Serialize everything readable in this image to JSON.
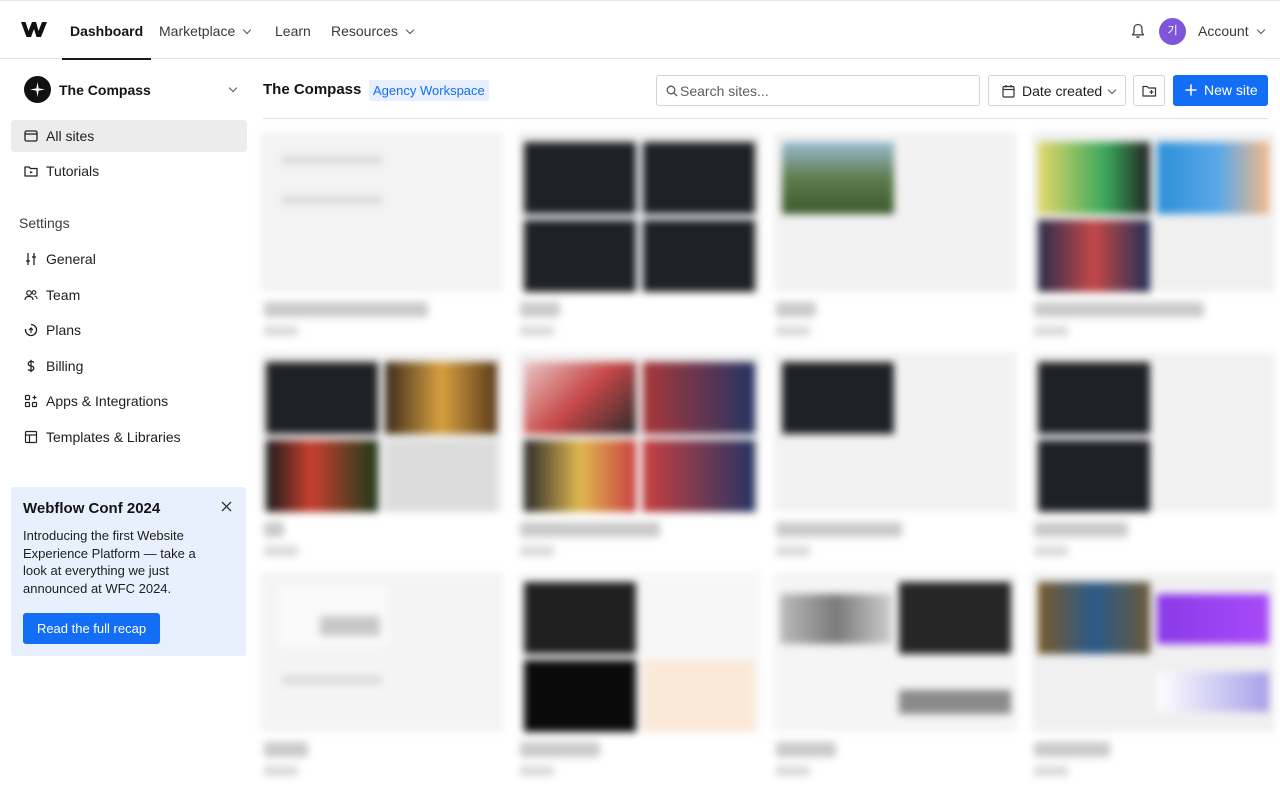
{
  "topnav": {
    "items": [
      {
        "label": "Dashboard",
        "active": true,
        "has_menu": false
      },
      {
        "label": "Marketplace",
        "active": false,
        "has_menu": true
      },
      {
        "label": "Learn",
        "active": false,
        "has_menu": false
      },
      {
        "label": "Resources",
        "active": false,
        "has_menu": true
      }
    ],
    "avatar_initial": "기",
    "account_label": "Account",
    "avatar_color": "#7d56d9"
  },
  "sidebar": {
    "workspace_name": "The Compass",
    "nav": [
      {
        "label": "All sites",
        "icon": "browser-window-icon",
        "active": true
      },
      {
        "label": "Tutorials",
        "icon": "video-folder-icon",
        "active": false
      }
    ],
    "settings_heading": "Settings",
    "settings": [
      {
        "label": "General",
        "icon": "sliders-icon"
      },
      {
        "label": "Team",
        "icon": "team-icon"
      },
      {
        "label": "Plans",
        "icon": "plans-icon"
      },
      {
        "label": "Billing",
        "icon": "dollar-icon"
      },
      {
        "label": "Apps & Integrations",
        "icon": "apps-icon"
      },
      {
        "label": "Templates & Libraries",
        "icon": "templates-icon"
      }
    ],
    "promo": {
      "title": "Webflow Conf 2024",
      "body": "Introducing the first Website Experience Platform — take a look at everything we just announced at WFC 2024.",
      "button_label": "Read the full recap"
    }
  },
  "main": {
    "title": "The Compass",
    "workspace_badge": "Agency Workspace",
    "search_placeholder": "Search sites...",
    "sort_label": "Date created",
    "new_site_label": "New site"
  },
  "colors": {
    "accent": "#146ef5",
    "badge_bg": "#e8f0fe",
    "promo_bg": "#e8f0fe"
  }
}
